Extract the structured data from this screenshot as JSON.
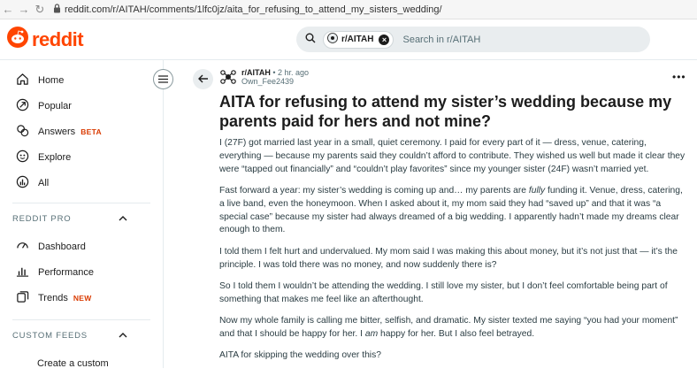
{
  "browser": {
    "url": "reddit.com/r/AITAH/comments/1lfc0jz/aita_for_refusing_to_attend_my_sisters_wedding/"
  },
  "header": {
    "logo_text": "reddit",
    "search": {
      "chip_label": "r/AITAH",
      "placeholder": "Search in r/AITAH"
    }
  },
  "sidebar": {
    "items": [
      {
        "label": "Home",
        "icon": "home-icon"
      },
      {
        "label": "Popular",
        "icon": "popular-icon"
      },
      {
        "label": "Answers",
        "icon": "answers-icon",
        "badge": "BETA"
      },
      {
        "label": "Explore",
        "icon": "explore-icon"
      },
      {
        "label": "All",
        "icon": "all-icon"
      }
    ],
    "pro_section": {
      "title": "REDDIT PRO",
      "items": [
        {
          "label": "Dashboard",
          "icon": "dashboard-icon"
        },
        {
          "label": "Performance",
          "icon": "performance-icon"
        },
        {
          "label": "Trends",
          "icon": "trends-icon",
          "badge": "NEW"
        }
      ]
    },
    "feeds_section": {
      "title": "CUSTOM FEEDS",
      "items": [
        {
          "label": "Create a custom"
        }
      ]
    }
  },
  "post": {
    "subreddit": "r/AITAH",
    "age": "• 2 hr. ago",
    "author": "Own_Fee2439",
    "more": "•••",
    "title": "AITA for refusing to attend my sister’s wedding because my parents paid for hers and not mine?",
    "paragraphs": [
      "I (27F) got married last year in a small, quiet ceremony. I paid for every part of it — dress, venue, catering, everything — because my parents said they couldn’t afford to contribute. They wished us well but made it clear they were “tapped out financially” and “couldn’t play favorites” since my younger sister (24F) wasn’t married yet.",
      {
        "before": "Fast forward a year: my sister’s wedding is coming up and… my parents are ",
        "em": "fully",
        "after": " funding it. Venue, dress, catering, a live band, even the honeymoon. When I asked about it, my mom said they had “saved up” and that it was “a special case” because my sister had always dreamed of a big wedding. I apparently hadn’t made my dreams clear enough to them."
      },
      "I told them I felt hurt and undervalued. My mom said I was making this about money, but it’s not just that — it’s the principle. I was told there was no money, and now suddenly there is?",
      "So I told them I wouldn’t be attending the wedding. I still love my sister, but I don’t feel comfortable being part of something that makes me feel like an afterthought.",
      {
        "before": "Now my whole family is calling me bitter, selfish, and dramatic. My sister texted me saying “you had your moment” and that I should be happy for her. I ",
        "em": "am",
        "after": " happy for her. But I also feel betrayed."
      },
      "AITA for skipping the wedding over this?"
    ]
  }
}
